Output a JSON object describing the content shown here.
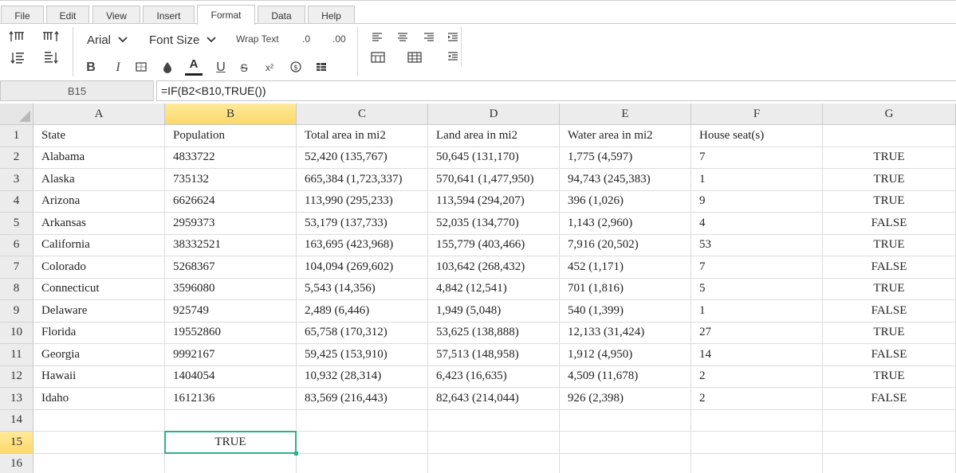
{
  "tabs": [
    "File",
    "Edit",
    "View",
    "Insert",
    "Format",
    "Data",
    "Help"
  ],
  "active_tab": "Format",
  "toolbar": {
    "font_name": "Arial",
    "font_size_label": "Font Size",
    "wrap_text": "Wrap Text",
    "decimal_decrease": ".0",
    "decimal_increase": ".00",
    "bold": "B",
    "italic": "I",
    "underline": "U",
    "strike": "S",
    "superscript": "x²",
    "font_color": "A"
  },
  "formula_bar": {
    "name_box": "B15",
    "formula": "=IF(B2<B10,TRUE())"
  },
  "columns": [
    "A",
    "B",
    "C",
    "D",
    "E",
    "F",
    "G"
  ],
  "selected_column": "B",
  "selected_row": "15",
  "rows": [
    {
      "num": "1",
      "cells": [
        "State",
        "Population",
        "Total area in mi2",
        "Land area in mi2",
        "Water area in mi2",
        "House seat(s)",
        ""
      ]
    },
    {
      "num": "2",
      "cells": [
        "Alabama",
        "4833722",
        "52,420 (135,767)",
        "50,645 (131,170)",
        "1,775 (4,597)",
        "7",
        "TRUE"
      ]
    },
    {
      "num": "3",
      "cells": [
        "Alaska",
        "735132",
        "665,384 (1,723,337)",
        "570,641 (1,477,950)",
        "94,743 (245,383)",
        "1",
        "TRUE"
      ]
    },
    {
      "num": "4",
      "cells": [
        "Arizona",
        "6626624",
        "113,990 (295,233)",
        "113,594 (294,207)",
        "396 (1,026)",
        "9",
        "TRUE"
      ]
    },
    {
      "num": "5",
      "cells": [
        "Arkansas",
        "2959373",
        "53,179 (137,733)",
        "52,035 (134,770)",
        "1,143 (2,960)",
        "4",
        "FALSE"
      ]
    },
    {
      "num": "6",
      "cells": [
        "California",
        "38332521",
        "163,695 (423,968)",
        "155,779 (403,466)",
        "7,916 (20,502)",
        "53",
        "TRUE"
      ]
    },
    {
      "num": "7",
      "cells": [
        "Colorado",
        "5268367",
        "104,094 (269,602)",
        "103,642 (268,432)",
        "452 (1,171)",
        "7",
        "FALSE"
      ]
    },
    {
      "num": "8",
      "cells": [
        "Connecticut",
        "3596080",
        "5,543 (14,356)",
        "4,842 (12,541)",
        "701 (1,816)",
        "5",
        "TRUE"
      ]
    },
    {
      "num": "9",
      "cells": [
        "Delaware",
        "925749",
        "2,489 (6,446)",
        "1,949 (5,048)",
        "540 (1,399)",
        "1",
        "FALSE"
      ]
    },
    {
      "num": "10",
      "cells": [
        "Florida",
        "19552860",
        "65,758 (170,312)",
        "53,625 (138,888)",
        "12,133 (31,424)",
        "27",
        "TRUE"
      ]
    },
    {
      "num": "11",
      "cells": [
        "Georgia",
        "9992167",
        "59,425 (153,910)",
        "57,513 (148,958)",
        "1,912 (4,950)",
        "14",
        "FALSE"
      ]
    },
    {
      "num": "12",
      "cells": [
        "Hawaii",
        "1404054",
        "10,932 (28,314)",
        "6,423 (16,635)",
        "4,509 (11,678)",
        "2",
        "TRUE"
      ]
    },
    {
      "num": "13",
      "cells": [
        "Idaho",
        "1612136",
        "83,569 (216,443)",
        "82,643 (214,044)",
        "926 (2,398)",
        "2",
        "FALSE"
      ]
    },
    {
      "num": "14",
      "cells": [
        "",
        "",
        "",
        "",
        "",
        "",
        ""
      ]
    },
    {
      "num": "15",
      "cells": [
        "",
        "TRUE",
        "",
        "",
        "",
        "",
        ""
      ]
    },
    {
      "num": "16",
      "cells": [
        "",
        "",
        "",
        "",
        "",
        "",
        ""
      ]
    }
  ],
  "colors": {
    "selection_border": "#2bb28d",
    "header_highlight": "#fcd96a"
  }
}
